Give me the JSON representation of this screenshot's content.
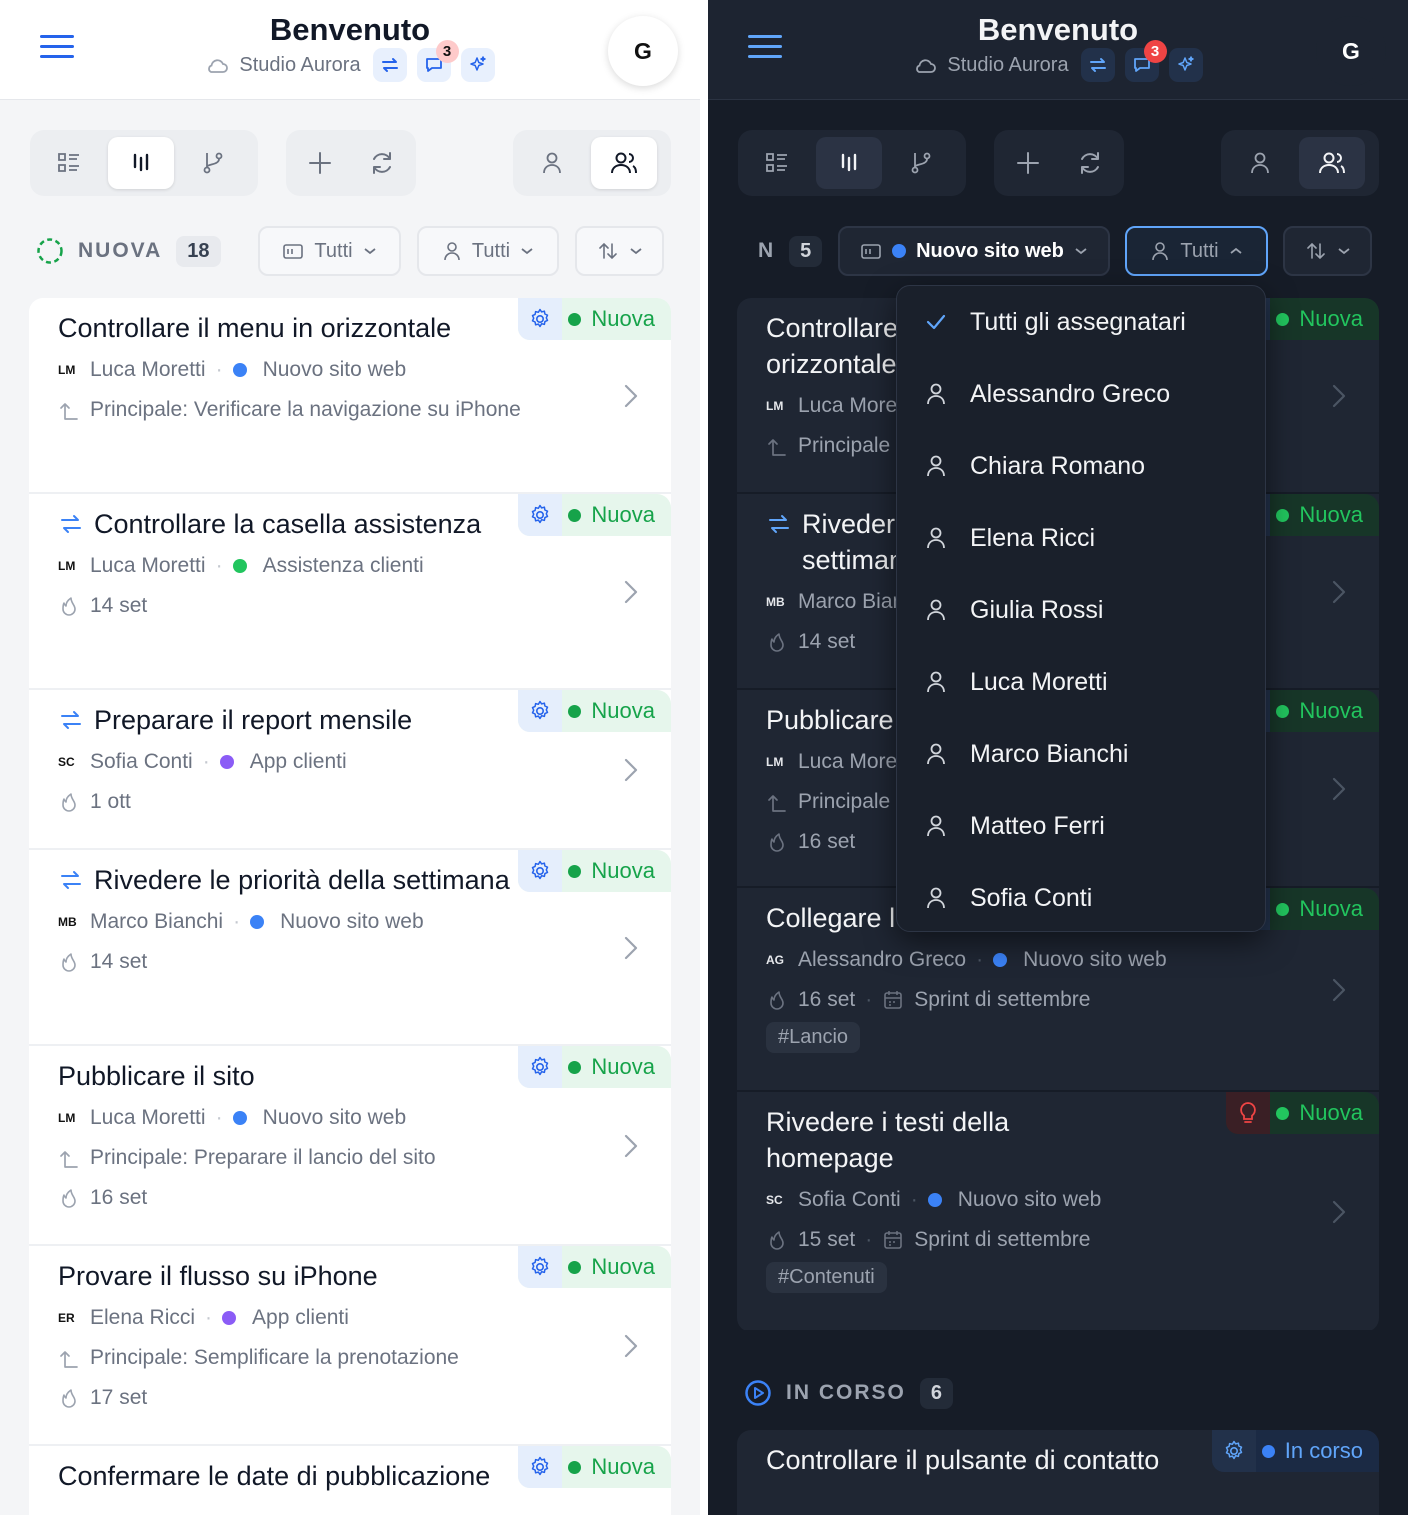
{
  "light": {
    "header": {
      "title": "Benvenuto",
      "workspace": "Studio Aurora",
      "notifications": "3",
      "avatar": "G"
    },
    "group": {
      "name": "NUOVA",
      "count": "18"
    },
    "filters": {
      "project": "Tutti",
      "assignee": "Tutti"
    },
    "cards": [
      {
        "title": "Controllare il menu in orizzontale",
        "recurring": false,
        "initials": "LM",
        "assignee": "Luca Moretti",
        "project": "Nuovo sito web",
        "project_color": "#3b82f6",
        "parent": "Principale: Verificare la navigazione su iPhone",
        "date": "",
        "status": "Nuova"
      },
      {
        "title": "Controllare la casella assistenza",
        "recurring": true,
        "initials": "LM",
        "assignee": "Luca Moretti",
        "project": "Assistenza clienti",
        "project_color": "#22c55e",
        "parent": "",
        "date": "14 set",
        "status": "Nuova"
      },
      {
        "title": "Preparare il report mensile",
        "recurring": true,
        "initials": "SC",
        "assignee": "Sofia Conti",
        "project": "App clienti",
        "project_color": "#8b5cf6",
        "parent": "",
        "date": "1 ott",
        "status": "Nuova"
      },
      {
        "title": "Rivedere le priorità della settimana",
        "recurring": true,
        "initials": "MB",
        "assignee": "Marco Bianchi",
        "project": "Nuovo sito web",
        "project_color": "#3b82f6",
        "parent": "",
        "date": "14 set",
        "status": "Nuova"
      },
      {
        "title": "Pubblicare il sito",
        "recurring": false,
        "initials": "LM",
        "assignee": "Luca Moretti",
        "project": "Nuovo sito web",
        "project_color": "#3b82f6",
        "parent": "Principale: Preparare il lancio del sito",
        "date": "16 set",
        "status": "Nuova"
      },
      {
        "title": "Provare il flusso su iPhone",
        "recurring": false,
        "initials": "ER",
        "assignee": "Elena Ricci",
        "project": "App clienti",
        "project_color": "#8b5cf6",
        "parent": "Principale: Semplificare la prenotazione",
        "date": "17 set",
        "status": "Nuova"
      },
      {
        "title": "Confermare le date di pubblicazione",
        "recurring": false,
        "initials": "",
        "assignee": "",
        "project": "",
        "project_color": "#3b82f6",
        "parent": "",
        "date": "",
        "status": "Nuova"
      }
    ]
  },
  "dark": {
    "header": {
      "title": "Benvenuto",
      "workspace": "Studio Aurora",
      "notifications": "3",
      "avatar": "G"
    },
    "group": {
      "name": "N",
      "count": "5"
    },
    "filters": {
      "project": "Nuovo sito web",
      "assignee": "Tutti"
    },
    "cards": [
      {
        "title_line1": "Controllare",
        "title_line2": "orizzontale",
        "recurring": false,
        "initials": "LM",
        "assignee": "Luca Moretti",
        "parent": "Principale",
        "date": "",
        "status": "Nuova"
      },
      {
        "title_line1": "Rivedere",
        "title_line2": "settimana",
        "recurring": true,
        "initials": "MB",
        "assignee": "Marco Bianchi",
        "parent": "",
        "date": "14 set",
        "status": "Nuova"
      },
      {
        "title_line1": "Pubblicare",
        "title_line2": "",
        "recurring": false,
        "initials": "LM",
        "assignee": "Luca Moretti",
        "parent": "Principale",
        "date": "16 set",
        "status": "Nuova"
      },
      {
        "title_line1": "Collegare l",
        "title_line2": "",
        "recurring": false,
        "initials": "AG",
        "assignee": "Alessandro Greco",
        "project": "Nuovo sito web",
        "date": "16 set",
        "sprint": "Sprint di settembre",
        "tag": "#Lancio",
        "status": "Nuova"
      },
      {
        "title_line1": "Rivedere i testi della",
        "title_line2": "homepage",
        "recurring": false,
        "initials": "SC",
        "assignee": "Sofia Conti",
        "project": "Nuovo sito web",
        "date": "15 set",
        "sprint": "Sprint di settembre",
        "tag": "#Contenuti",
        "status": "Nuova"
      }
    ],
    "group2": {
      "name": "IN CORSO",
      "count": "6"
    },
    "card2": {
      "title": "Controllare il pulsante di contatto",
      "status": "In corso"
    },
    "dropdown": [
      "Tutti gli assegnatari",
      "Alessandro Greco",
      "Chiara Romano",
      "Elena Ricci",
      "Giulia Rossi",
      "Luca Moretti",
      "Marco Bianchi",
      "Matteo Ferri",
      "Sofia Conti"
    ]
  },
  "colors": {
    "accent": "#2563eb",
    "status_green": "#16a34a",
    "status_blue": "#3b82f6",
    "project_blue": "#3b82f6",
    "project_green": "#22c55e",
    "project_purple": "#8b5cf6"
  }
}
